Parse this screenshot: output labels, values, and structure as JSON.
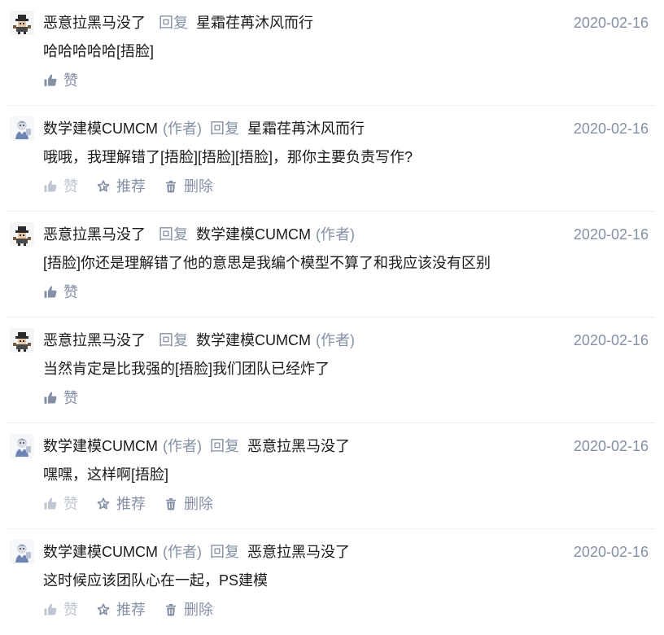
{
  "comments": [
    {
      "author": "恶意拉黑马没了",
      "author_tag": "",
      "reply_label": "回复",
      "reply_to": "星霜荏苒沐风而行",
      "reply_to_tag": "",
      "date": "2020-02-16",
      "content": "哈哈哈哈哈[捂脸]",
      "avatar_icon": "pixel-character-avatar",
      "actions": [
        {
          "label": "赞",
          "icon": "thumbs-up-icon",
          "faded": false
        }
      ]
    },
    {
      "author": "数学建模CUMCM",
      "author_tag": "(作者)",
      "reply_label": "回复",
      "reply_to": "星霜荏苒沐风而行",
      "reply_to_tag": "",
      "date": "2020-02-16",
      "content": "哦哦，我理解错了[捂脸][捂脸][捂脸]，那你主要负责写作?",
      "avatar_icon": "cartoon-character-avatar",
      "actions": [
        {
          "label": "赞",
          "icon": "thumbs-up-icon",
          "faded": true
        },
        {
          "label": "推荐",
          "icon": "star-icon",
          "faded": false
        },
        {
          "label": "删除",
          "icon": "trash-icon",
          "faded": false
        }
      ]
    },
    {
      "author": "恶意拉黑马没了",
      "author_tag": "",
      "reply_label": "回复",
      "reply_to": "数学建模CUMCM",
      "reply_to_tag": "(作者)",
      "date": "2020-02-16",
      "content": "[捂脸]你还是理解错了他的意思是我编个模型不算了和我应该没有区别",
      "avatar_icon": "pixel-character-avatar",
      "actions": [
        {
          "label": "赞",
          "icon": "thumbs-up-icon",
          "faded": false
        }
      ]
    },
    {
      "author": "恶意拉黑马没了",
      "author_tag": "",
      "reply_label": "回复",
      "reply_to": "数学建模CUMCM",
      "reply_to_tag": "(作者)",
      "date": "2020-02-16",
      "content": "当然肯定是比我强的[捂脸]我们团队已经炸了",
      "avatar_icon": "pixel-character-avatar",
      "actions": [
        {
          "label": "赞",
          "icon": "thumbs-up-icon",
          "faded": false
        }
      ]
    },
    {
      "author": "数学建模CUMCM",
      "author_tag": "(作者)",
      "reply_label": "回复",
      "reply_to": "恶意拉黑马没了",
      "reply_to_tag": "",
      "date": "2020-02-16",
      "content": "嘿嘿，这样啊[捂脸]",
      "avatar_icon": "cartoon-character-avatar",
      "actions": [
        {
          "label": "赞",
          "icon": "thumbs-up-icon",
          "faded": true
        },
        {
          "label": "推荐",
          "icon": "star-icon",
          "faded": false
        },
        {
          "label": "删除",
          "icon": "trash-icon",
          "faded": false
        }
      ]
    },
    {
      "author": "数学建模CUMCM",
      "author_tag": "(作者)",
      "reply_label": "回复",
      "reply_to": "恶意拉黑马没了",
      "reply_to_tag": "",
      "date": "2020-02-16",
      "content": "这时候应该团队心在一起，PS建模",
      "avatar_icon": "cartoon-character-avatar",
      "actions": [
        {
          "label": "赞",
          "icon": "thumbs-up-icon",
          "faded": true
        },
        {
          "label": "推荐",
          "icon": "star-icon",
          "faded": false
        },
        {
          "label": "删除",
          "icon": "trash-icon",
          "faded": false
        }
      ]
    }
  ],
  "colors": {
    "text": "#1a1a1a",
    "muted": "#8590a6",
    "faded": "#c0c6d2",
    "divider": "#eceff3"
  }
}
